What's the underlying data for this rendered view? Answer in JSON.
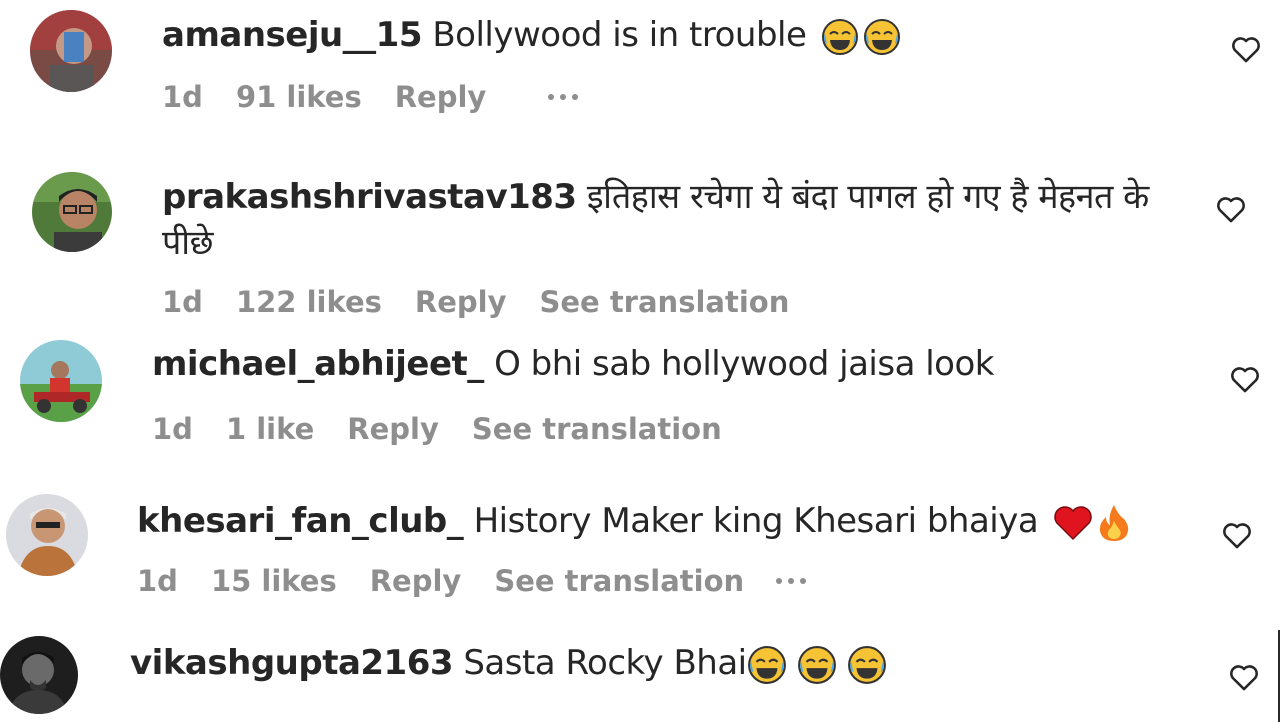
{
  "comments": [
    {
      "username": "amanseju__15",
      "text": "Bollywood is in trouble",
      "emojis": [
        "face-with-tears-of-joy",
        "face-with-tears-of-joy"
      ],
      "time": "1d",
      "likes": "91 likes",
      "reply": "Reply",
      "translation": ""
    },
    {
      "username": "prakashshrivastav183",
      "text": "इतिहास रचेगा ये बंदा पागल हो गए है मेहनत के पीछे",
      "emojis": [],
      "time": "1d",
      "likes": "122 likes",
      "reply": "Reply",
      "translation": "See translation"
    },
    {
      "username": "michael_abhijeet_",
      "text": "O bhi sab hollywood jaisa look",
      "emojis": [],
      "time": "1d",
      "likes": "1 like",
      "reply": "Reply",
      "translation": "See translation"
    },
    {
      "username": "khesari_fan_club_",
      "text": "History Maker king Khesari bhaiya",
      "emojis": [
        "red-heart",
        "fire"
      ],
      "time": "1d",
      "likes": "15 likes",
      "reply": "Reply",
      "translation": "See translation"
    },
    {
      "username": "vikashgupta2163",
      "text": "Sasta Rocky Bhai",
      "emojis": [
        "face-with-tears-of-joy",
        "face-with-tears-of-joy",
        "face-with-tears-of-joy"
      ],
      "time": "",
      "likes": "",
      "reply": "",
      "translation": ""
    }
  ],
  "icons": {
    "like": "heart-outline-icon",
    "more": "more-options-icon"
  },
  "colors": {
    "text": "#262626",
    "meta": "#8e8e8e",
    "emoji_face": "#f6c334",
    "tears": "#4aa8e8",
    "heart": "#e0141f",
    "fire": "#f47a1c"
  }
}
